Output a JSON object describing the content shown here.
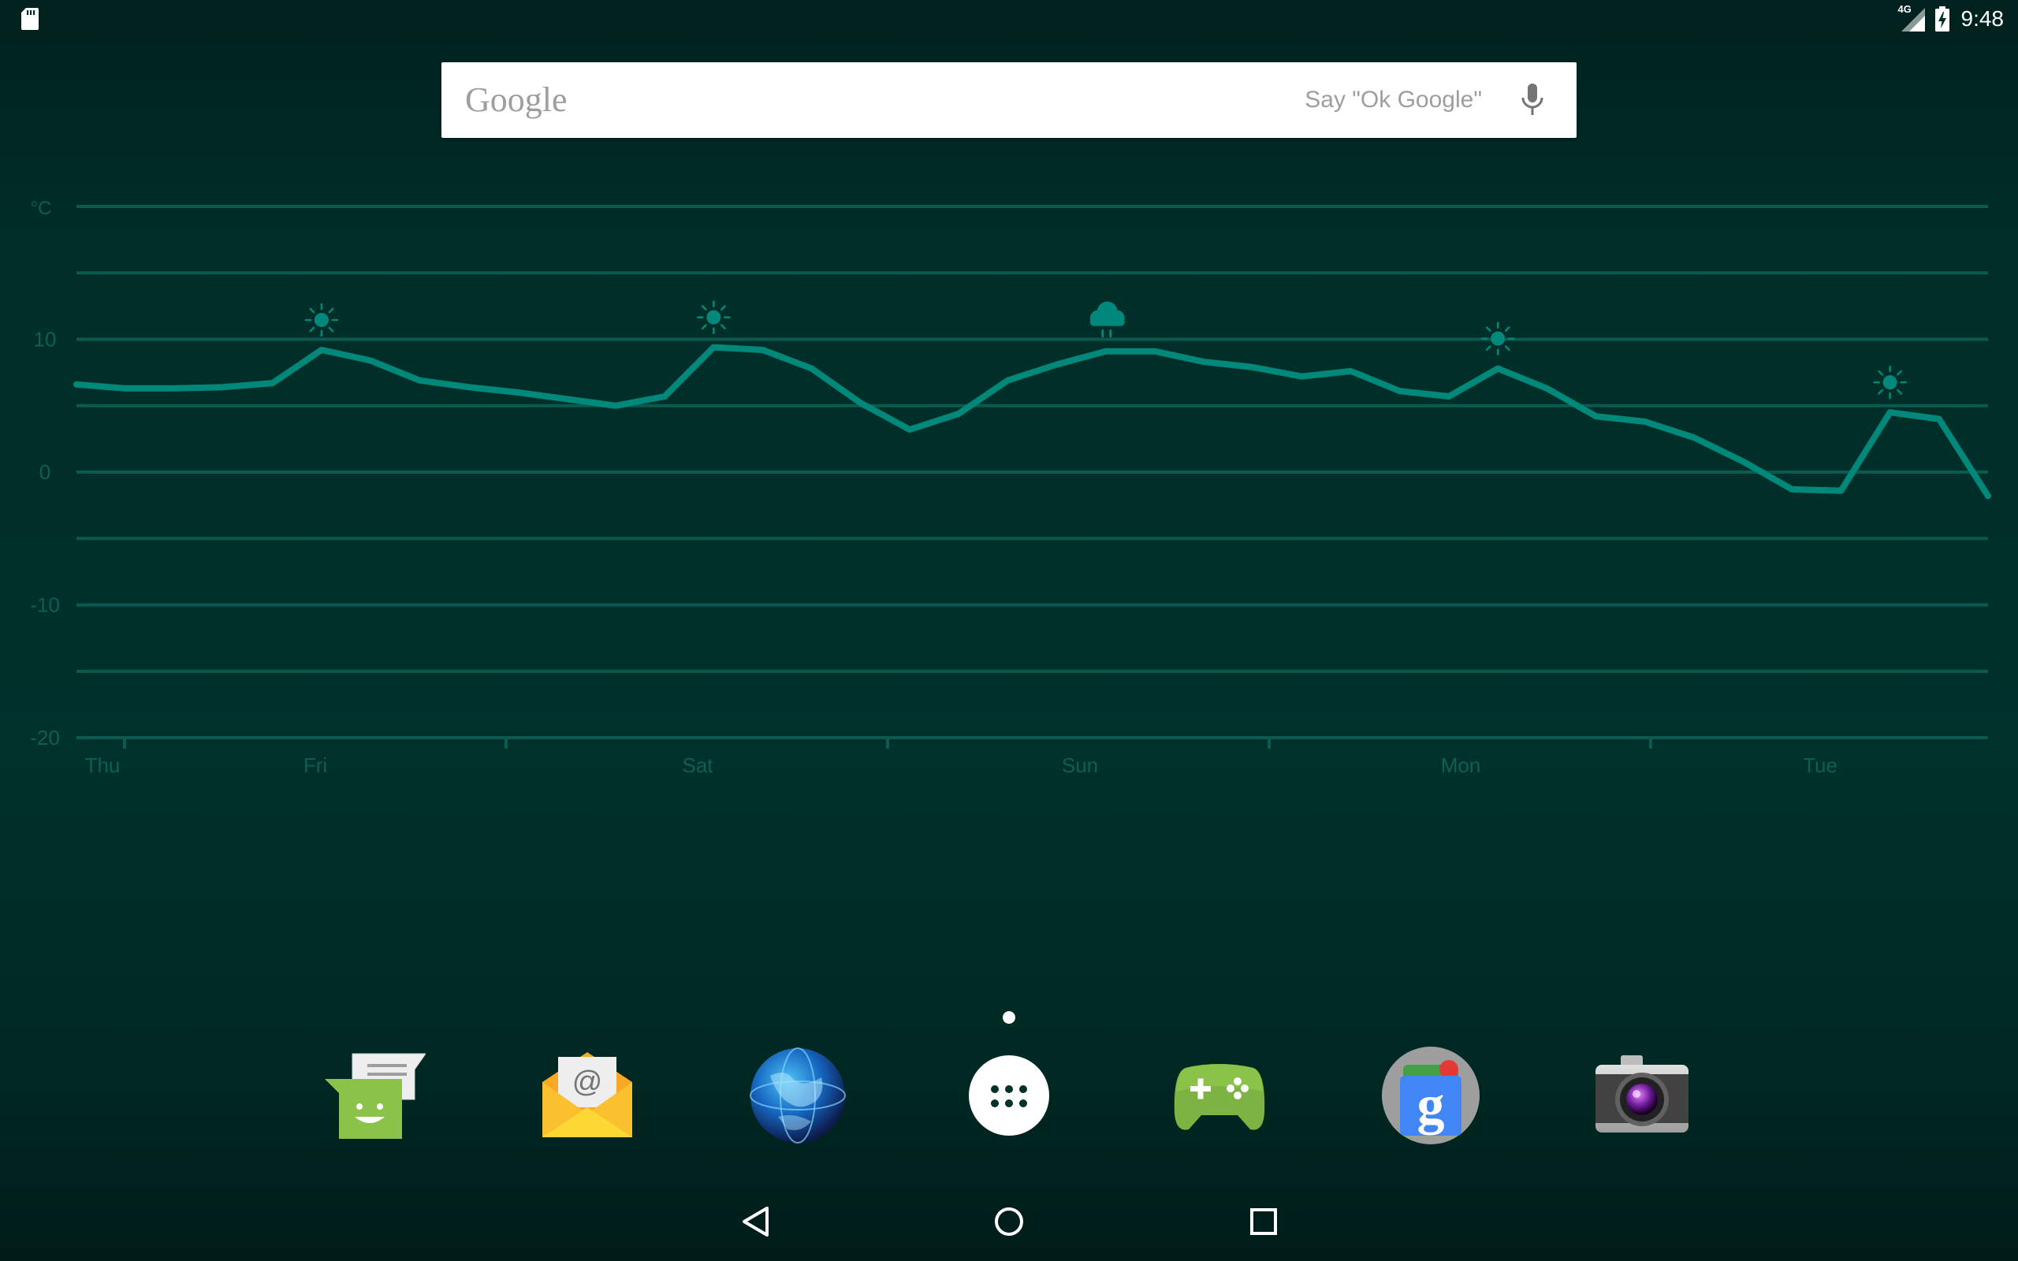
{
  "status_bar": {
    "time": "9:48",
    "network_type": "4G",
    "icons": [
      "sd-card-icon",
      "signal-icon",
      "battery-charging-icon"
    ]
  },
  "search": {
    "logo": "Google",
    "hint": "Say \"Ok Google\"",
    "icon": "mic-icon"
  },
  "chart_data": {
    "type": "line",
    "unit_label": "°C",
    "y_ticks": [
      "10",
      "0",
      "-10",
      "-20"
    ],
    "ylim": [
      -20,
      20
    ],
    "day_labels": [
      "Thu",
      "Fri",
      "Sat",
      "Sun",
      "Mon",
      "Tue"
    ],
    "grid": true,
    "color": "#00897b",
    "temperatures": [
      6.6,
      6.3,
      6.3,
      6.4,
      6.7,
      9.2,
      8.4,
      6.9,
      6.4,
      6.0,
      5.5,
      5.0,
      5.7,
      9.4,
      9.2,
      7.8,
      5.2,
      3.2,
      4.4,
      6.9,
      8.1,
      9.1,
      9.1,
      8.3,
      7.9,
      7.2,
      7.6,
      6.1,
      5.7,
      7.8,
      6.3,
      4.2,
      3.8,
      2.6,
      0.8,
      -1.3,
      -1.4,
      4.5,
      4.0,
      -1.8
    ],
    "weather_icons": [
      {
        "type": "sun",
        "time_index": 5
      },
      {
        "type": "sun",
        "time_index": 13
      },
      {
        "type": "rain-cloud",
        "time_index": 21
      },
      {
        "type": "sun",
        "time_index": 29
      },
      {
        "type": "sun",
        "time_index": 37
      }
    ]
  },
  "dock": {
    "apps": [
      {
        "name": "Messenger",
        "icon": "messenger-icon"
      },
      {
        "name": "Email",
        "icon": "email-icon"
      },
      {
        "name": "Browser",
        "icon": "browser-globe-icon"
      },
      {
        "name": "All apps",
        "icon": "app-drawer-icon"
      },
      {
        "name": "Play Games",
        "icon": "play-games-icon"
      },
      {
        "name": "Google",
        "icon": "google-app-icon"
      },
      {
        "name": "Camera",
        "icon": "camera-icon"
      }
    ]
  },
  "nav": {
    "buttons": [
      "back-icon",
      "home-icon",
      "recents-icon"
    ]
  },
  "colors": {
    "background": "#003129",
    "accent": "#00897b",
    "grid": "#0b5a50",
    "axis_text": "#0f5e54"
  }
}
